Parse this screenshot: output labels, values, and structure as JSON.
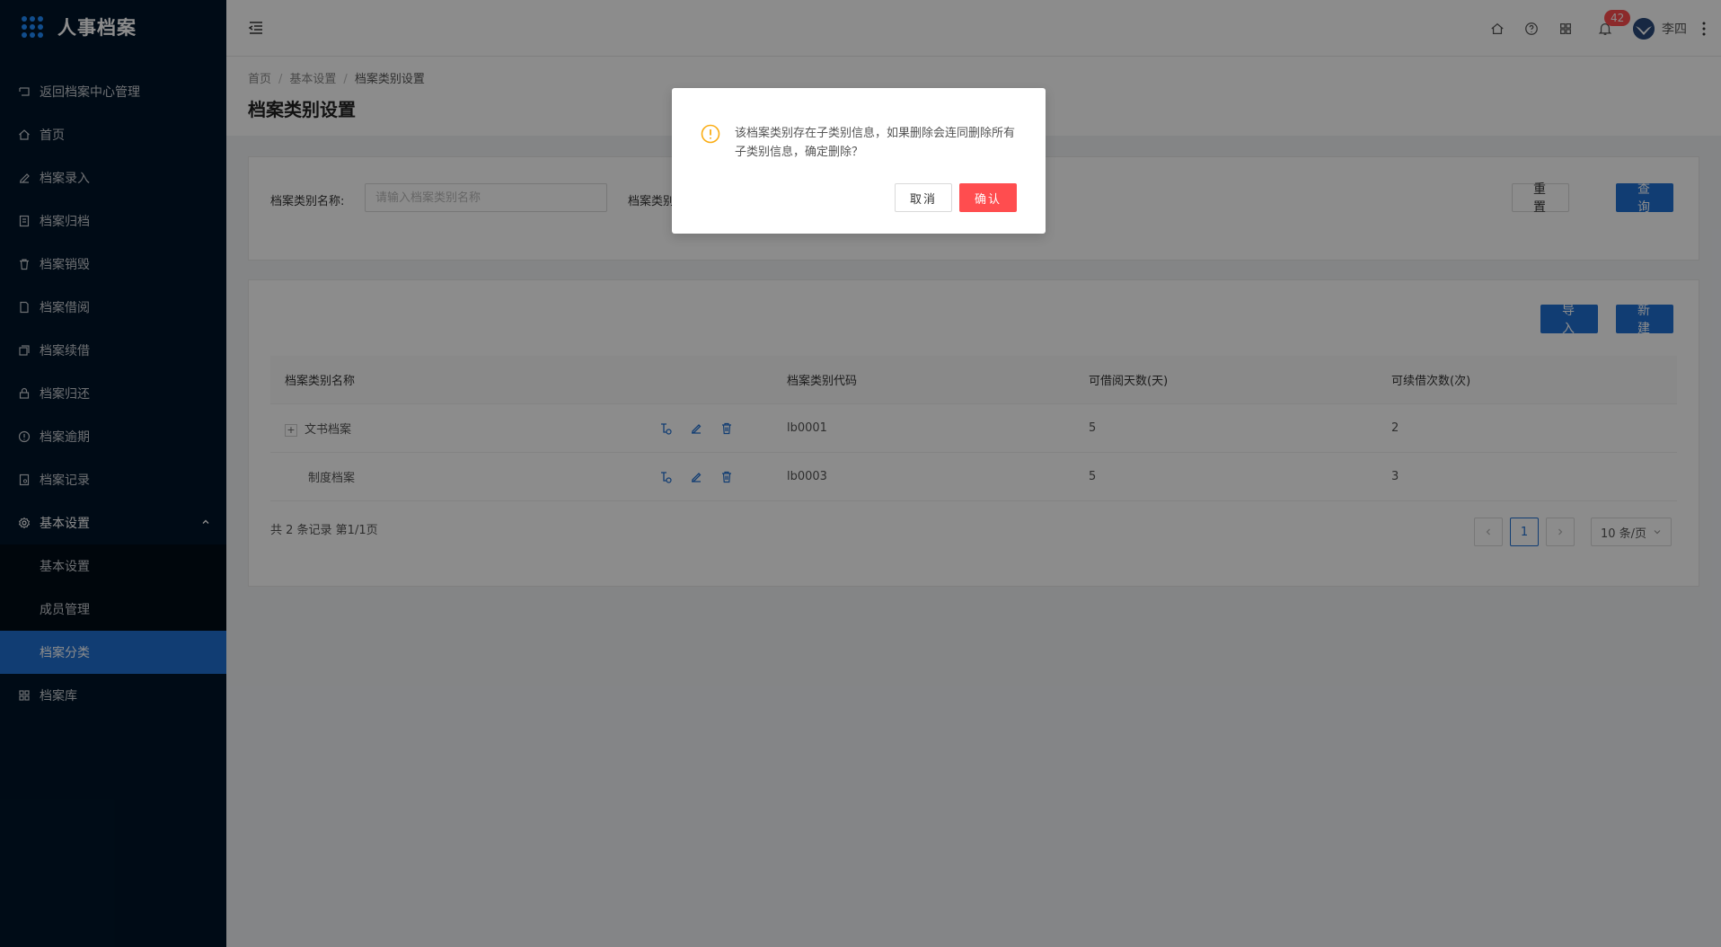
{
  "app": {
    "title": "人事档案"
  },
  "sidebar": {
    "items": [
      {
        "label": "返回档案中心管理",
        "icon": "return-icon"
      },
      {
        "label": "首页",
        "icon": "home-icon"
      },
      {
        "label": "档案录入",
        "icon": "edit-icon"
      },
      {
        "label": "档案归档",
        "icon": "archive-icon"
      },
      {
        "label": "档案销毁",
        "icon": "trash-icon"
      },
      {
        "label": "档案借阅",
        "icon": "book-icon"
      },
      {
        "label": "档案续借",
        "icon": "renew-icon"
      },
      {
        "label": "档案归还",
        "icon": "lock-icon"
      },
      {
        "label": "档案逾期",
        "icon": "alert-icon"
      },
      {
        "label": "档案记录",
        "icon": "record-icon"
      },
      {
        "label": "基本设置",
        "icon": "gear-icon"
      },
      {
        "label": "档案库",
        "icon": "grid-icon"
      }
    ],
    "submenu": [
      {
        "label": "基本设置"
      },
      {
        "label": "成员管理"
      },
      {
        "label": "档案分类"
      }
    ]
  },
  "header": {
    "notification_count": "42",
    "username": "李四"
  },
  "page": {
    "breadcrumb": [
      "首页",
      "基本设置",
      "档案类别设置"
    ],
    "separator": "/",
    "title": "档案类别设置"
  },
  "search": {
    "label": "档案类别名称:",
    "placeholder": "请输入档案类别名称",
    "label2": "档案类别",
    "reset_label": "重置",
    "query_label": "查询"
  },
  "toolbar": {
    "import_label": "导入",
    "new_label": "新建"
  },
  "table": {
    "columns": [
      "档案类别名称",
      "档案类别代码",
      "可借阅天数(天)",
      "可续借次数(次)"
    ],
    "rows": [
      {
        "name": "文书档案",
        "code": "lb0001",
        "days": "5",
        "times": "2",
        "expand": "+"
      },
      {
        "name": "制度档案",
        "code": "lb0003",
        "days": "5",
        "times": "3"
      }
    ],
    "summary": "共 2 条记录 第1/1页"
  },
  "pagination": {
    "current": "1",
    "page_size": "10 条/页"
  },
  "modal": {
    "message": "该档案类别存在子类别信息，如果删除会连同删除所有子类别信息，确定删除？",
    "cancel_label": "取消",
    "confirm_label": "确认",
    "colors": {
      "warning": "#faad14",
      "danger": "#ff4d4f"
    }
  }
}
